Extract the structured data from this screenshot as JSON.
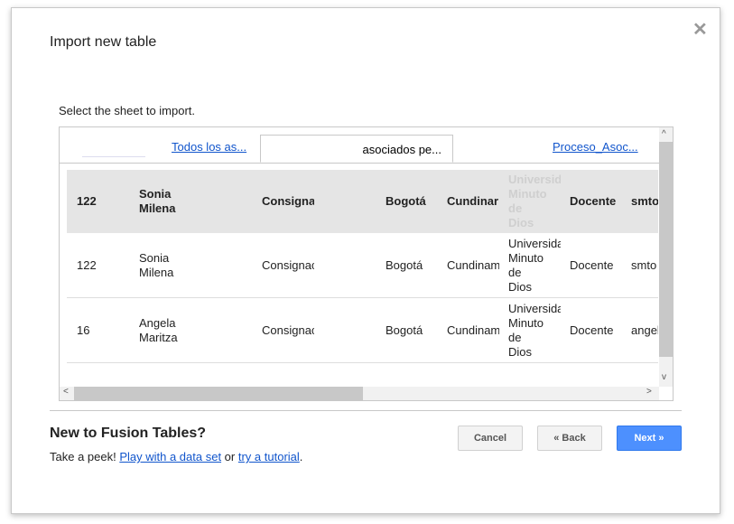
{
  "dialog": {
    "title": "Import new table",
    "close_icon": "close-icon",
    "prompt": "Select the sheet to import."
  },
  "tabs": [
    {
      "label": "Todos los as...",
      "active": false
    },
    {
      "label": "asociados pe...",
      "active": true
    },
    {
      "label": "Proceso_Asoc...",
      "active": false
    }
  ],
  "table": {
    "header": [
      "122",
      "Sonia\nMilena",
      "Consigna",
      "Bogotá",
      "Cundinar",
      "Universid\nMinuto\nde\nDios",
      "Docente",
      "smto"
    ],
    "rows": [
      [
        "122",
        "Sonia\nMilena",
        "Consignac",
        "Bogotá",
        "Cundinam",
        "Universida\nMinuto\nde\nDios",
        "Docente",
        "smto"
      ],
      [
        "16",
        "Angela\nMaritza",
        "Consignac",
        "Bogotá",
        "Cundinam",
        "Universida\nMinuto\nde\nDios",
        "Docente",
        "angel"
      ]
    ]
  },
  "footer": {
    "heading": "New to Fusion Tables?",
    "peek_prefix": "Take a peek! ",
    "link1": "Play with a data set",
    "middle": " or ",
    "link2": "try a tutorial",
    "suffix": "."
  },
  "buttons": {
    "cancel": "Cancel",
    "back": "« Back",
    "next": "Next »"
  },
  "colors": {
    "primary": "#4d90fe",
    "link": "#1155cc"
  }
}
